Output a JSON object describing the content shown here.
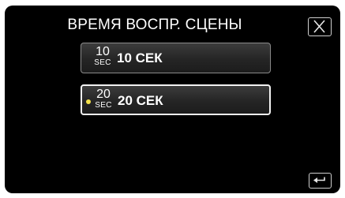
{
  "screen": {
    "title": "ВРЕМЯ ВОСПР. СЦЕНЫ"
  },
  "options": [
    {
      "num": "10",
      "unit": "SEC",
      "label": "10 СЕК",
      "selected": false
    },
    {
      "num": "20",
      "unit": "SEC",
      "label": "20 СЕК",
      "selected": true
    }
  ],
  "icons": {
    "close": "close-icon",
    "back": "back-arrow-icon",
    "selected_marker": "selected-dot-icon"
  },
  "colors": {
    "background": "#000000",
    "text": "#ffffff",
    "selected_marker": "#f4e24a"
  }
}
